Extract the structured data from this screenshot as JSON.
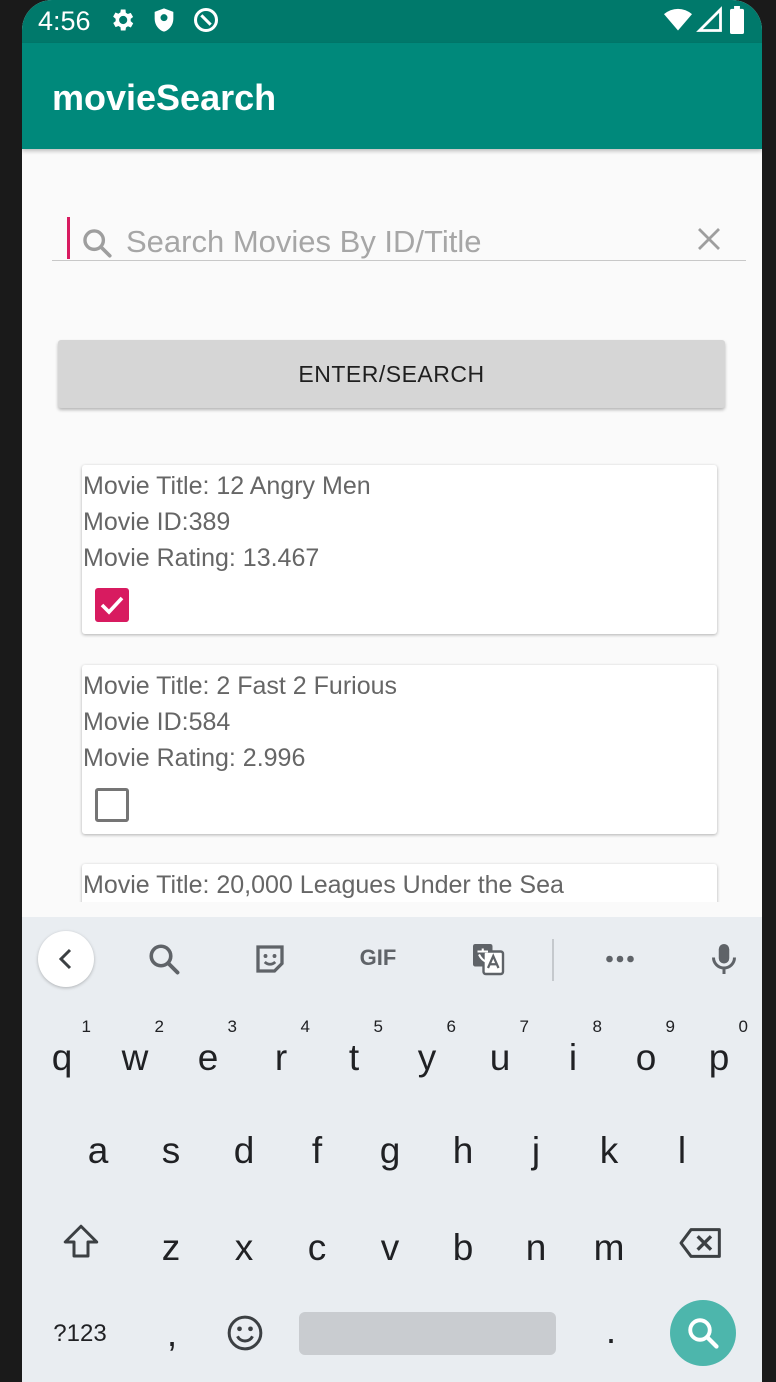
{
  "status_bar": {
    "time": "4:56",
    "left_icons": [
      "gear-icon",
      "shield-icon",
      "at-sign-icon"
    ],
    "right_icons": [
      "wifi-icon",
      "signal-icon",
      "battery-icon"
    ]
  },
  "app_bar": {
    "title": "movieSearch",
    "color": "#00897b"
  },
  "search": {
    "placeholder": "Search Movies By ID/Title",
    "value": ""
  },
  "enter_button": {
    "label": "ENTER/SEARCH"
  },
  "movies": [
    {
      "title": "Movie Title: 12 Angry Men",
      "id": "Movie ID:389",
      "rating": "Movie Rating: 13.467",
      "checked": true
    },
    {
      "title": "Movie Title: 2 Fast 2 Furious",
      "id": "Movie ID:584",
      "rating": "Movie Rating: 2.996",
      "checked": false
    },
    {
      "title": "Movie Title: 20,000 Leagues Under the Sea"
    }
  ],
  "keyboard": {
    "toolbar_icons": [
      "chevron-left-icon",
      "search-icon",
      "sticker-icon",
      "gif-icon",
      "translate-icon",
      "more-icon",
      "mic-icon"
    ],
    "gif_label": "GIF",
    "row1": [
      {
        "k": "q",
        "h": "1"
      },
      {
        "k": "w",
        "h": "2"
      },
      {
        "k": "e",
        "h": "3"
      },
      {
        "k": "r",
        "h": "4"
      },
      {
        "k": "t",
        "h": "5"
      },
      {
        "k": "y",
        "h": "6"
      },
      {
        "k": "u",
        "h": "7"
      },
      {
        "k": "i",
        "h": "8"
      },
      {
        "k": "o",
        "h": "9"
      },
      {
        "k": "p",
        "h": "0"
      }
    ],
    "row2": [
      "a",
      "s",
      "d",
      "f",
      "g",
      "h",
      "j",
      "k",
      "l"
    ],
    "row3": [
      "z",
      "x",
      "c",
      "v",
      "b",
      "n",
      "m"
    ],
    "symbols_label": "?123",
    "comma": ",",
    "period": ".",
    "accent_color": "#4db6ac"
  }
}
